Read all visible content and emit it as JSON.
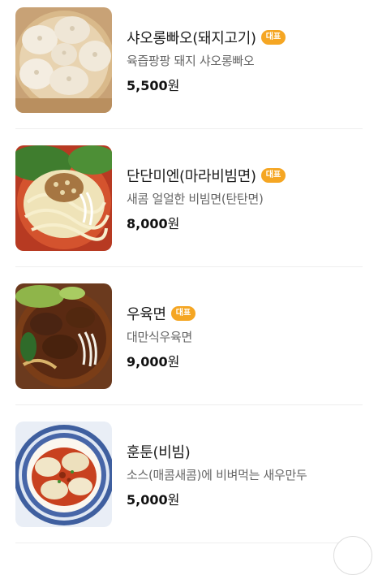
{
  "menu": {
    "items": [
      {
        "name": "샤오롱빠오(돼지고기)",
        "badge": "대표",
        "description": "육즙팡팡 돼지 샤오롱빠오",
        "price": "5,500",
        "currency": "원",
        "image_icon": "xiaolongbao-photo"
      },
      {
        "name": "단단미엔(마라비빔면)",
        "badge": "대표",
        "description": "새콤 얼얼한 비빔면(탄탄면)",
        "price": "8,000",
        "currency": "원",
        "image_icon": "dandan-noodles-photo"
      },
      {
        "name": "우육면",
        "badge": "대표",
        "description": "대만식우육면",
        "price": "9,000",
        "currency": "원",
        "image_icon": "beef-noodle-soup-photo"
      },
      {
        "name": "훈툰(비빔)",
        "badge": "",
        "description": "소스(매콤새콤)에 비벼먹는 새우만두",
        "price": "5,000",
        "currency": "원",
        "image_icon": "wonton-photo"
      }
    ]
  },
  "colors": {
    "badge_bg": "#f5a623",
    "badge_text": "#ffffff",
    "divider": "#eeeeee",
    "description": "#666666"
  }
}
